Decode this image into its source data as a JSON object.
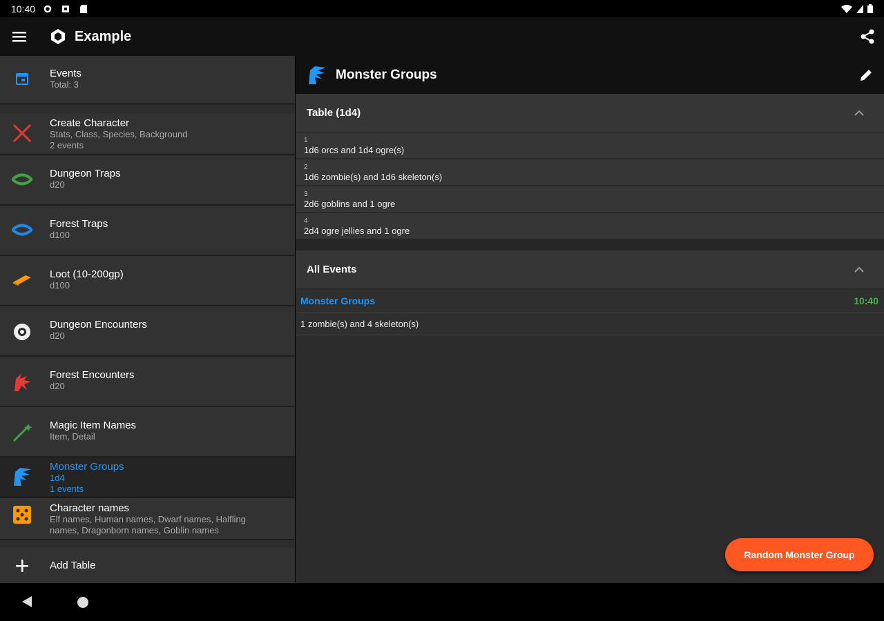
{
  "status_bar": {
    "time": "10:40"
  },
  "app_bar": {
    "title": "Example"
  },
  "sidebar": {
    "events": {
      "label": "Events",
      "sub": "Total: 3"
    },
    "items": [
      {
        "label": "Create Character",
        "sub1": "Stats, Class, Species, Background",
        "sub2": "2 events",
        "icon": "crossed-swords-icon",
        "color": "#e53935"
      },
      {
        "label": "Dungeon Traps",
        "sub1": "d20",
        "icon": "trap-icon",
        "color": "#43a047"
      },
      {
        "label": "Forest Traps",
        "sub1": "d100",
        "icon": "trap-icon",
        "color": "#1e88e5"
      },
      {
        "label": "Loot (10-200gp)",
        "sub1": "d100",
        "icon": "gold-bar-icon",
        "color": "#ff9800"
      },
      {
        "label": "Dungeon Encounters",
        "sub1": "d20",
        "icon": "eye-monster-icon",
        "color": "#eeeeee"
      },
      {
        "label": "Forest Encounters",
        "sub1": "d20",
        "icon": "dragon-icon",
        "color": "#e53935"
      },
      {
        "label": "Magic Item Names",
        "sub1": "Item, Detail",
        "icon": "magic-wand-icon",
        "color": "#43a047"
      },
      {
        "label": "Monster Groups",
        "sub1": "1d4",
        "sub2": "1 events",
        "icon": "monster-icon",
        "color": "#2196f3"
      },
      {
        "label": "Character names",
        "sub1": "Elf names, Human names, Dwarf names, Halfling",
        "sub2": "names, Dragonborn names, Goblin names",
        "icon": "dice-icon",
        "color": "#ff9800"
      }
    ],
    "add_table": "Add Table"
  },
  "main": {
    "title": "Monster Groups",
    "table_header": "Table (1d4)",
    "rows": [
      {
        "num": "1",
        "text": "1d6 orcs and 1d4 ogre(s)"
      },
      {
        "num": "2",
        "text": "1d6 zombie(s) and 1d6 skeleton(s)"
      },
      {
        "num": "3",
        "text": "2d6 goblins and 1 ogre"
      },
      {
        "num": "4",
        "text": "2d4 ogre jellies and 1 ogre"
      }
    ],
    "events_header": "All Events",
    "event": {
      "name": "Monster Groups",
      "time": "10:40",
      "result": "1 zombie(s) and 4 skeleton(s)"
    },
    "fab_label": "Random Monster Group"
  },
  "colors": {
    "accent_blue": "#2196f3",
    "fab_orange": "#ff5722",
    "time_green": "#4caf50"
  }
}
